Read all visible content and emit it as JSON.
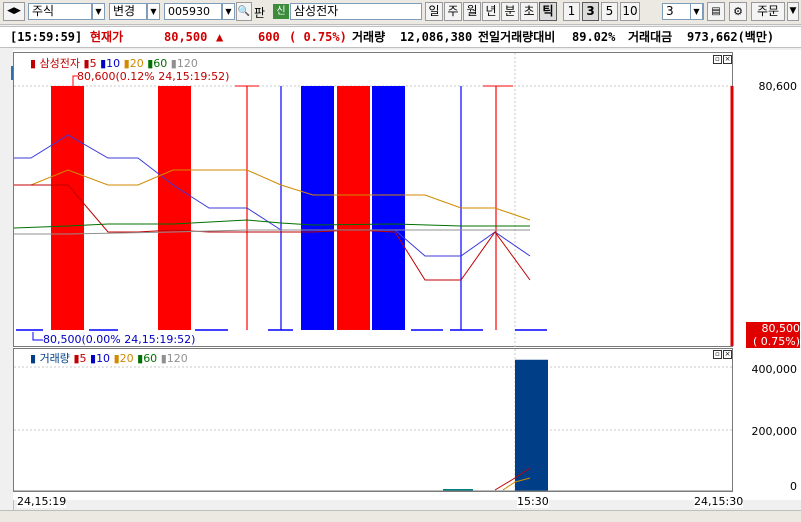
{
  "toolbar": {
    "market_label": "주식",
    "change_label": "변경",
    "stock_code": "005930",
    "pan_label": "판",
    "credit_badge": "신",
    "stock_name": "삼성전자",
    "periods": [
      "일",
      "주",
      "월",
      "년",
      "분",
      "초",
      "틱"
    ],
    "tick_buttons": [
      "1",
      "3",
      "5",
      "10"
    ],
    "tick_count": "3",
    "order_label": "주문",
    "icons": [
      "arrow-left-right-icon",
      "dropdown-icon",
      "search-icon",
      "save-icon",
      "gear-icon"
    ]
  },
  "quote": {
    "time": "[15:59:59]",
    "price_label": "현재가",
    "price": "80,500",
    "arrow": "▲",
    "change": "600",
    "change_pct": "( 0.75%)",
    "volume_label": "거래량",
    "volume": "12,086,380",
    "prev_vol_label": "전일거래량대비",
    "prev_vol_pct": "89.02%",
    "amount_label": "거래대금",
    "amount": "973,662(백만)"
  },
  "price_pane": {
    "legend": [
      "삼성전자",
      "5",
      "10",
      "20",
      "60",
      "120"
    ],
    "legend_colors": [
      "#c00000",
      "#c00000",
      "#0000c0",
      "#d08a00",
      "#007000",
      "#909090"
    ],
    "high_annotation": "80,600(0.12% 24,15:19:52)",
    "low_annotation": "80,500(0.00% 24,15:19:52)",
    "y_label_top": "80,600",
    "current_tag": "80,500",
    "current_tag_pct": "( 0.75%)"
  },
  "volume_pane": {
    "legend": [
      "거래량",
      "5",
      "10",
      "20",
      "60",
      "120"
    ],
    "y_labels": [
      "400,000",
      "200,000",
      "0"
    ]
  },
  "x_labels": [
    "24,15:19",
    "15:30",
    "24,15:30"
  ],
  "chart_data": [
    {
      "type": "bar",
      "title": "삼성전자",
      "series_note": "tick candles",
      "candles": [
        {
          "open": 80600,
          "close": 80500,
          "color": "red"
        },
        {
          "open": 80500,
          "close": 80600,
          "color": "red"
        },
        {
          "open": 80600,
          "close": 80600,
          "color": "red"
        },
        {
          "open": 80600,
          "close": 80600,
          "color": "blue"
        },
        {
          "open": 80600,
          "close": 80500,
          "color": "blue"
        },
        {
          "open": 80500,
          "close": 80600,
          "color": "red"
        },
        {
          "open": 80600,
          "close": 80500,
          "color": "blue"
        },
        {
          "open": 80600,
          "close": 80600,
          "color": "red"
        }
      ],
      "ylim": [
        80500,
        80600
      ]
    },
    {
      "type": "bar",
      "title": "거래량",
      "values": [
        0,
        0,
        0,
        0,
        0,
        0,
        0,
        420000
      ],
      "ylim": [
        0,
        450000
      ]
    }
  ],
  "colors": {
    "up": "#ff0000",
    "down": "#0000ff",
    "volume": "#003f88",
    "ma5": "#c00000",
    "ma10": "#3b3bdc",
    "ma20": "#d08a00",
    "ma60": "#007000",
    "ma120": "#909090"
  }
}
